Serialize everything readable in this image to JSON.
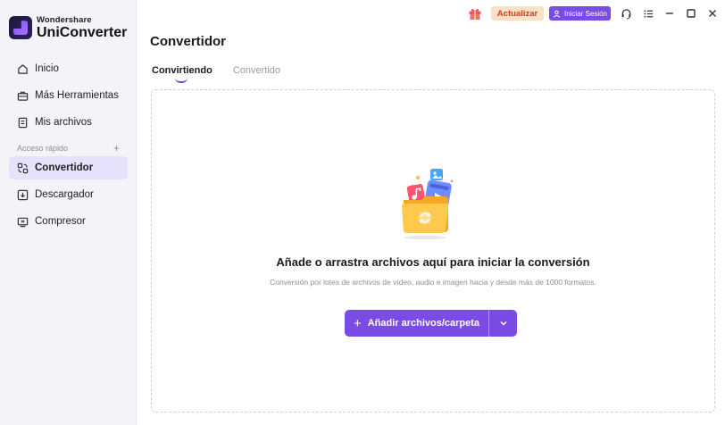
{
  "brand": {
    "company": "Wondershare",
    "product": "UniConverter"
  },
  "sidebar": {
    "items": [
      {
        "label": "Inicio",
        "icon": "home-icon"
      },
      {
        "label": "Más Herramientas",
        "icon": "toolbox-icon"
      },
      {
        "label": "Mis archivos",
        "icon": "file-icon"
      }
    ],
    "section_label": "Acceso rápido",
    "quick_items": [
      {
        "label": "Convertidor",
        "icon": "converter-icon",
        "active": true
      },
      {
        "label": "Descargador",
        "icon": "download-icon"
      },
      {
        "label": "Compresor",
        "icon": "compress-icon"
      }
    ]
  },
  "titlebar": {
    "update_label": "Actualizar",
    "login_label": "Iniciar Sesión",
    "icons": [
      "gift-icon",
      "headset-icon",
      "menu-icon",
      "minimize-icon",
      "maximize-icon",
      "close-icon"
    ]
  },
  "main": {
    "title": "Convertidor",
    "tabs": [
      {
        "label": "Convirtiendo",
        "active": true
      },
      {
        "label": "Convertido",
        "active": false
      }
    ],
    "drop_title": "Añade o arrastra archivos aquí para iniciar la conversión",
    "drop_subtitle": "Conversión por lotes de archivos de vídeo, audio e imagen hacia y desde más de 1000 formatos.",
    "add_button_label": "Añadir archivos/carpeta"
  },
  "colors": {
    "accent": "#7b4be6",
    "sidebar_bg": "#f3f3f8",
    "active_nav_bg": "#e6e2fb",
    "update_bg": "#fde0c6",
    "update_text": "#d8361a"
  }
}
